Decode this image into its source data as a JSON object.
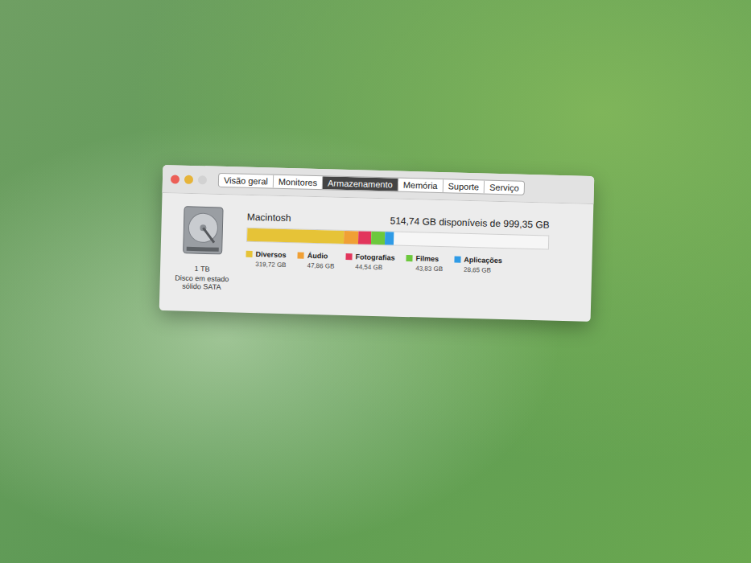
{
  "window": {
    "controls": [
      {
        "name": "close",
        "color": "#ec5f57"
      },
      {
        "name": "minimize",
        "color": "#e6b43a"
      },
      {
        "name": "zoom",
        "color": "#d2d2d2"
      }
    ]
  },
  "tabs": [
    {
      "label": "Visão geral",
      "selected": false
    },
    {
      "label": "Monitores",
      "selected": false
    },
    {
      "label": "Armazenamento",
      "selected": true
    },
    {
      "label": "Memória",
      "selected": false
    },
    {
      "label": "Suporte",
      "selected": false
    },
    {
      "label": "Serviço",
      "selected": false
    }
  ],
  "disk": {
    "capacity": "1 TB",
    "type": "Disco em estado sólido SATA"
  },
  "volume": {
    "name": "Macintosh",
    "available": "514,74 GB disponíveis de 999,35 GB"
  },
  "categories": [
    {
      "label": "Diversos",
      "size": "319,72 GB",
      "level": 0.32,
      "color": "#e6c337"
    },
    {
      "label": "Áudio",
      "size": "47,86 GB",
      "level": 0.048,
      "color": "#f0a035"
    },
    {
      "label": "Fotografias",
      "size": "44,54 GB",
      "level": 0.045,
      "color": "#e2365c"
    },
    {
      "label": "Filmes",
      "size": "43,83 GB",
      "level": 0.044,
      "color": "#6cc83c"
    },
    {
      "label": "Aplicações",
      "size": "28,65 GB",
      "level": 0.029,
      "color": "#2f9be6"
    }
  ]
}
